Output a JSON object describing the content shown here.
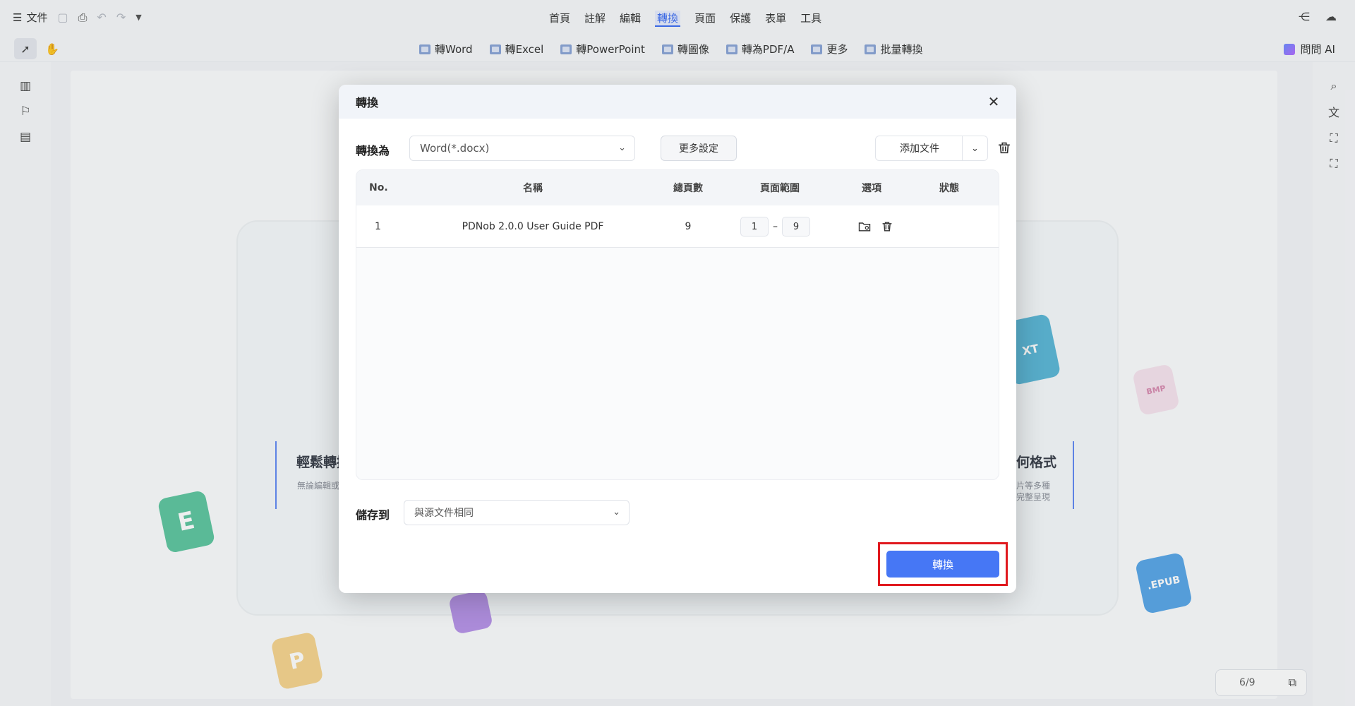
{
  "topbar": {
    "file_label": "文件",
    "menu": [
      "首頁",
      "註解",
      "編輯",
      "轉換",
      "頁面",
      "保護",
      "表單",
      "工具"
    ],
    "active_menu": "轉換"
  },
  "convert_toolbar": {
    "items": [
      "轉Word",
      "轉Excel",
      "轉PowerPoint",
      "轉圖像",
      "轉為PDF/A",
      "更多",
      "批量轉換"
    ],
    "ask_ai": "問問 AI"
  },
  "background": {
    "left_title": "輕鬆轉換",
    "left_sub": "無論編輯或",
    "right_title": "何格式",
    "right_sub": "片等多種\n完整呈現",
    "tiles": {
      "excel": "E",
      "ppt": "P",
      "bmp": "BMP",
      "epub": ".EPUB",
      "txt": "XT"
    }
  },
  "page_indicator": "6/9",
  "dialog": {
    "title": "轉換",
    "convert_to_label": "轉換為",
    "format_value": "Word(*.docx)",
    "more_settings": "更多設定",
    "add_file": "添加文件",
    "table": {
      "headers": [
        "No.",
        "名稱",
        "總頁數",
        "頁面範圍",
        "選項",
        "狀態"
      ],
      "rows": [
        {
          "no": "1",
          "name": "PDNob 2.0.0 User Guide PDF",
          "pages": "9",
          "range_from": "1",
          "range_to": "9",
          "status": ""
        }
      ],
      "range_dash": "–"
    },
    "save_to_label": "儲存到",
    "save_to_value": "與源文件相同",
    "convert_button": "轉換"
  },
  "colors": {
    "accent": "#4677f5",
    "highlight": "#e0191e"
  }
}
